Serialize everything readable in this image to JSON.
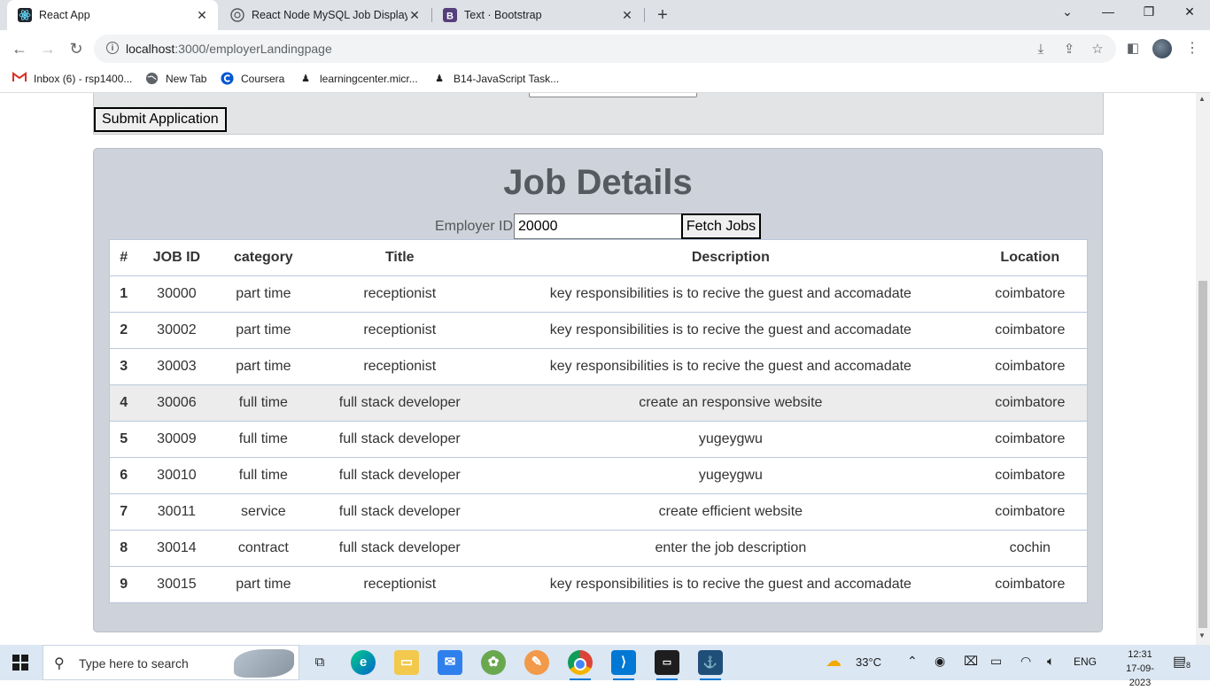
{
  "browser": {
    "tabs": [
      {
        "label": "React App",
        "active": true,
        "icon": "react-icon"
      },
      {
        "label": "React Node MySQL Job Display",
        "active": false,
        "icon": "chatgpt-icon"
      },
      {
        "label": "Text · Bootstrap",
        "active": false,
        "icon": "bootstrap-icon"
      }
    ],
    "url_host": "localhost",
    "url_path": ":3000/employerLandingpage"
  },
  "bookmarks": [
    {
      "label": "Inbox (6) - rsp1400...",
      "icon": "gmail-icon"
    },
    {
      "label": "New Tab",
      "icon": "globe-icon"
    },
    {
      "label": "Coursera",
      "icon": "coursera-icon"
    },
    {
      "label": "learningcenter.micr...",
      "icon": "person-icon"
    },
    {
      "label": "B14-JavaScript Task...",
      "icon": "person-icon"
    }
  ],
  "form": {
    "submit_label": "Submit Application"
  },
  "jobs": {
    "title": "Job Details",
    "employer_label": "Employer ID:",
    "employer_value": "20000",
    "fetch_label": "Fetch Jobs",
    "columns": [
      "#",
      "JOB ID",
      "category",
      "Title",
      "Description",
      "Location"
    ],
    "rows": [
      {
        "idx": "1",
        "job_id": "30000",
        "category": "part time",
        "title": "receptionist",
        "description": "key responsibilities is to recive the guest and accomadate",
        "location": "coimbatore"
      },
      {
        "idx": "2",
        "job_id": "30002",
        "category": "part time",
        "title": "receptionist",
        "description": "key responsibilities is to recive the guest and accomadate",
        "location": "coimbatore"
      },
      {
        "idx": "3",
        "job_id": "30003",
        "category": "part time",
        "title": "receptionist",
        "description": "key responsibilities is to recive the guest and accomadate",
        "location": "coimbatore"
      },
      {
        "idx": "4",
        "job_id": "30006",
        "category": "full time",
        "title": "full stack developer",
        "description": "create an responsive website",
        "location": "coimbatore"
      },
      {
        "idx": "5",
        "job_id": "30009",
        "category": "full time",
        "title": "full stack developer",
        "description": "yugeygwu",
        "location": "coimbatore"
      },
      {
        "idx": "6",
        "job_id": "30010",
        "category": "full time",
        "title": "full stack developer",
        "description": "yugeygwu",
        "location": "coimbatore"
      },
      {
        "idx": "7",
        "job_id": "30011",
        "category": "service",
        "title": "full stack developer",
        "description": "create efficient website",
        "location": "coimbatore"
      },
      {
        "idx": "8",
        "job_id": "30014",
        "category": "contract",
        "title": "full stack developer",
        "description": "enter the job description",
        "location": "cochin"
      },
      {
        "idx": "9",
        "job_id": "30015",
        "category": "part time",
        "title": "receptionist",
        "description": "key responsibilities is to recive the guest and accomadate",
        "location": "coimbatore"
      }
    ],
    "highlighted_row": 4
  },
  "taskbar": {
    "search_placeholder": "Type here to search",
    "weather": "33°C",
    "language": "ENG",
    "time": "12:31",
    "date": "17-09-2023",
    "notification_count": "8"
  }
}
